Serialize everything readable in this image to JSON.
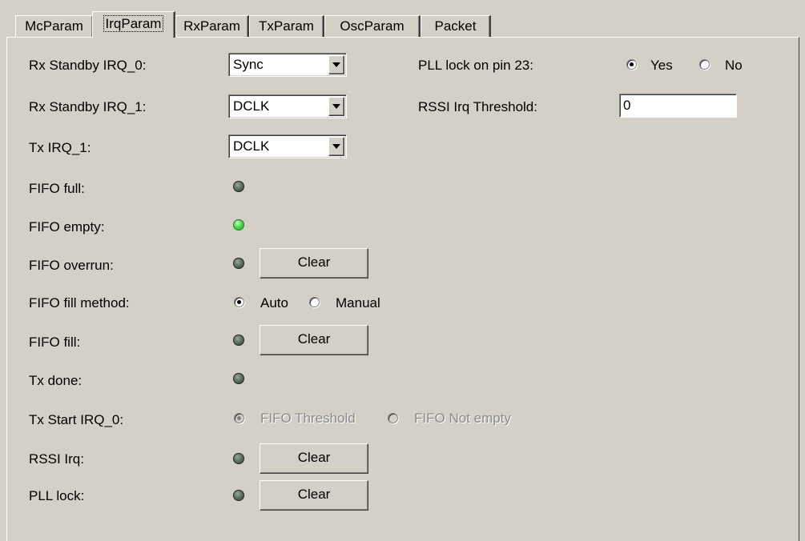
{
  "tabs": [
    {
      "label": "McParam",
      "active": false
    },
    {
      "label": "IrqParam",
      "active": true
    },
    {
      "label": "RxParam",
      "active": false
    },
    {
      "label": "TxParam",
      "active": false
    },
    {
      "label": "OscParam",
      "active": false
    },
    {
      "label": "Packet",
      "active": false
    }
  ],
  "left": {
    "rx_standby_irq0": {
      "label": "Rx Standby IRQ_0:",
      "value": "Sync"
    },
    "rx_standby_irq1": {
      "label": "Rx Standby IRQ_1:",
      "value": "DCLK"
    },
    "tx_irq1": {
      "label": "Tx IRQ_1:",
      "value": "DCLK"
    },
    "fifo_full": {
      "label": "FIFO full:",
      "led": "off"
    },
    "fifo_empty": {
      "label": "FIFO empty:",
      "led": "on"
    },
    "fifo_overrun": {
      "label": "FIFO overrun:",
      "led": "off",
      "button": "Clear"
    },
    "fifo_fill_method": {
      "label": "FIFO fill method:",
      "options": [
        "Auto",
        "Manual"
      ],
      "selected": "Auto"
    },
    "fifo_fill": {
      "label": "FIFO fill:",
      "led": "off",
      "button": "Clear"
    },
    "tx_done": {
      "label": "Tx done:",
      "led": "off"
    },
    "tx_start_irq0": {
      "label": "Tx Start IRQ_0:",
      "options": [
        "FIFO Threshold",
        "FIFO Not empty"
      ],
      "selected": "FIFO Threshold",
      "disabled": true
    },
    "rssi_irq": {
      "label": "RSSI Irq:",
      "led": "off",
      "button": "Clear"
    },
    "pll_lock": {
      "label": "PLL lock:",
      "led": "off",
      "button": "Clear"
    }
  },
  "right": {
    "pll_lock_pin23": {
      "label": "PLL lock on pin 23:",
      "options": [
        "Yes",
        "No"
      ],
      "selected": "Yes"
    },
    "rssi_threshold": {
      "label": "RSSI Irq Threshold:",
      "value": "0"
    }
  },
  "colors": {
    "background": "#d4d0c8",
    "led_on": "#46d346",
    "led_off": "#5d6d5d"
  }
}
